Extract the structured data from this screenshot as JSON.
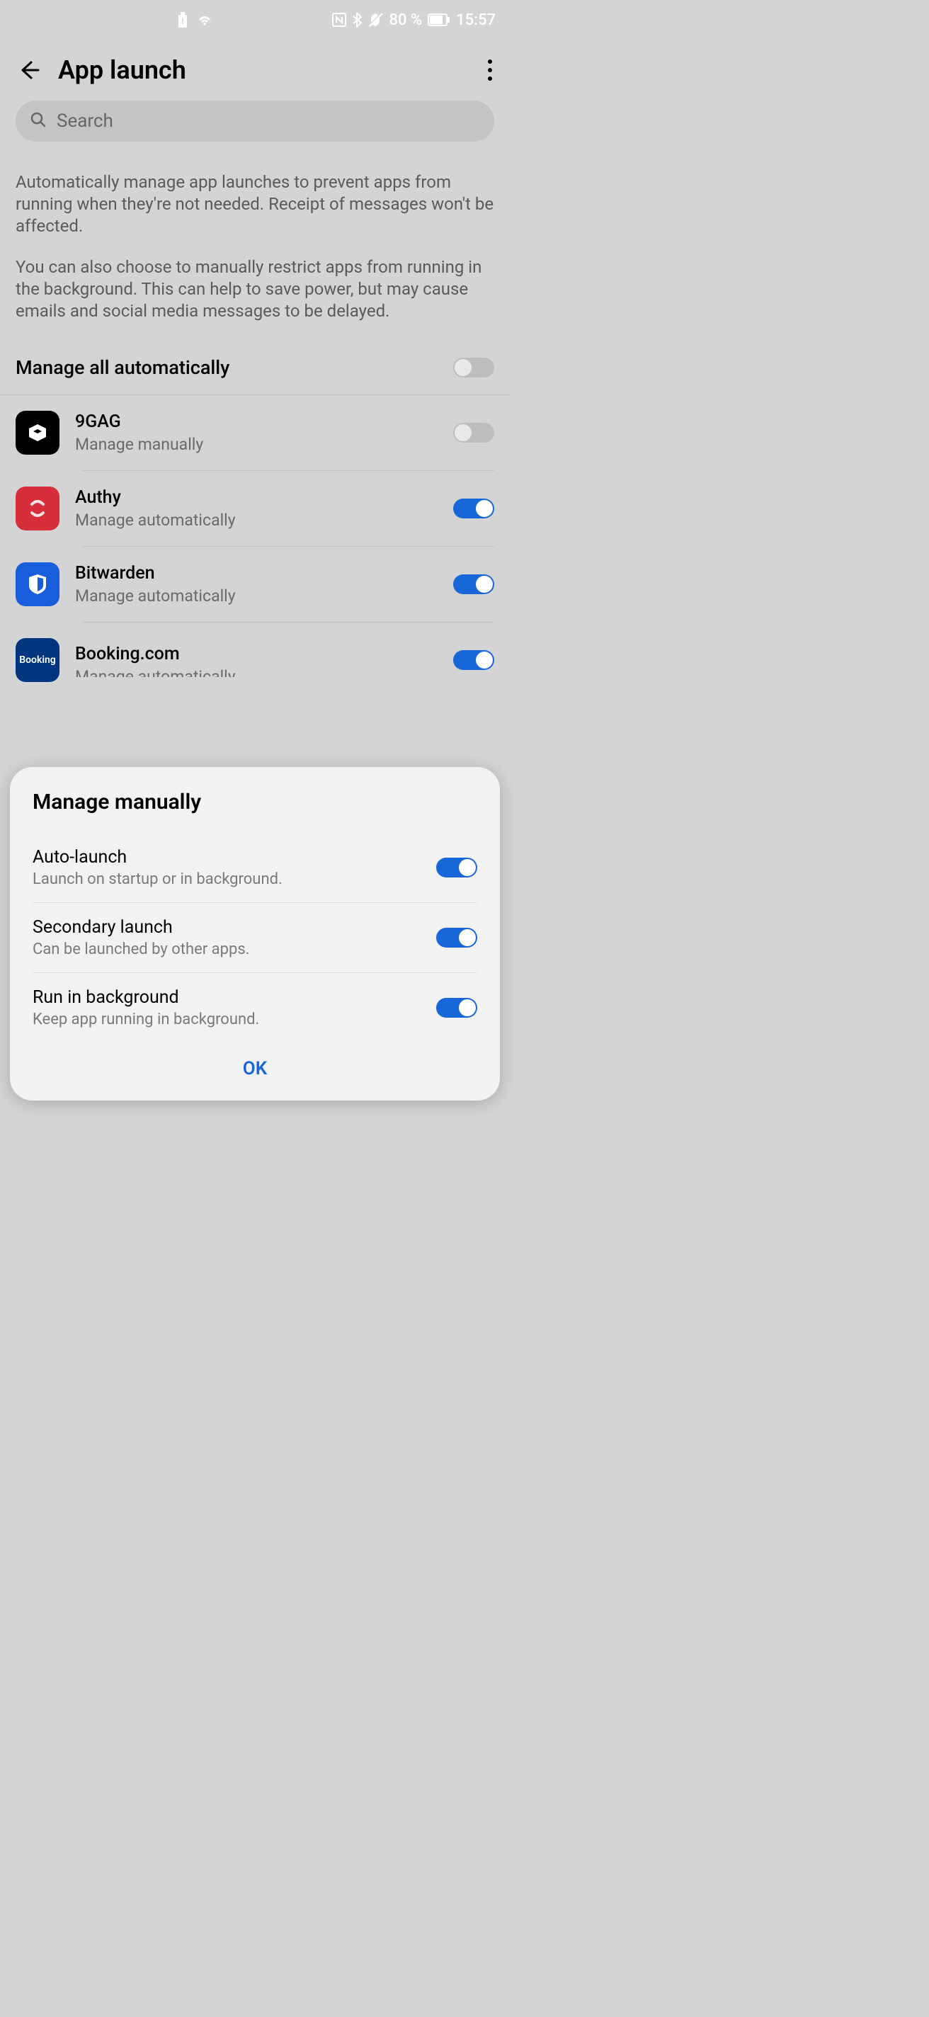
{
  "status": {
    "battery": "80 %",
    "time": "15:57"
  },
  "header": {
    "title": "App launch"
  },
  "search": {
    "placeholder": "Search"
  },
  "description": {
    "p1": "Automatically manage app launches to prevent apps from running when they're not needed. Receipt of messages won't be affected.",
    "p2": "You can also choose to manually restrict apps from running in the background. This can help to save power, but may cause emails and social media messages to be delayed."
  },
  "manage_all": {
    "label": "Manage all automatically"
  },
  "apps": [
    {
      "name": "9GAG",
      "sub": "Manage manually"
    },
    {
      "name": "Authy",
      "sub": "Manage automatically"
    },
    {
      "name": "Bitwarden",
      "sub": "Manage automatically"
    },
    {
      "name": "Booking.com",
      "sub": "Manage automatically",
      "icon_text": "Booking"
    }
  ],
  "dialog": {
    "title": "Manage manually",
    "rows": [
      {
        "label": "Auto-launch",
        "sub": "Launch on startup or in background."
      },
      {
        "label": "Secondary launch",
        "sub": "Can be launched by other apps."
      },
      {
        "label": "Run in background",
        "sub": "Keep app running in background."
      }
    ],
    "ok": "OK"
  }
}
